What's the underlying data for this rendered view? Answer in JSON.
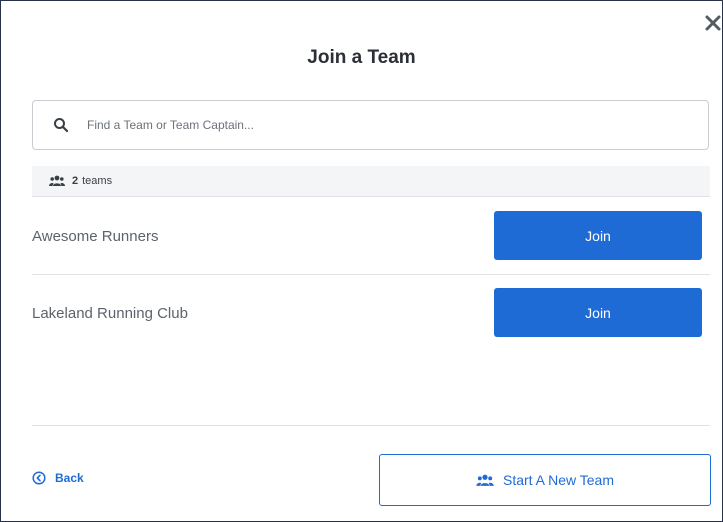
{
  "modal": {
    "title": "Join a Team",
    "close_icon": "close-icon"
  },
  "search": {
    "placeholder": "Find a Team or Team Captain...",
    "value": "",
    "icon": "search-icon"
  },
  "team_count": {
    "icon": "users-icon",
    "count": "2",
    "label": "teams"
  },
  "teams": [
    {
      "name": "Awesome Runners",
      "button_label": "Join"
    },
    {
      "name": "Lakeland Running Club",
      "button_label": "Join"
    }
  ],
  "footer": {
    "back_label": "Back",
    "back_icon": "chevron-left-circle-icon",
    "new_team_label": "Start A New Team",
    "new_team_icon": "users-icon"
  },
  "colors": {
    "accent": "#1f6bd6",
    "border_dark": "#27324a",
    "text_muted": "#5d636b"
  }
}
